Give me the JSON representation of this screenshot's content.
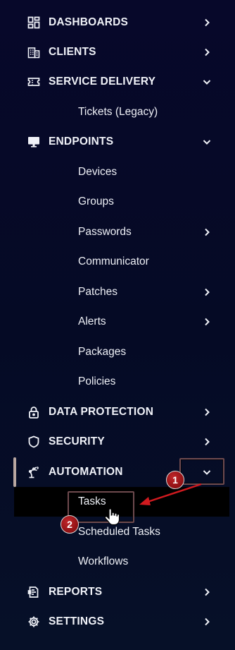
{
  "nav": {
    "dashboards": "DASHBOARDS",
    "clients": "CLIENTS",
    "service_delivery": "SERVICE DELIVERY",
    "tickets_legacy": "Tickets (Legacy)",
    "endpoints": "ENDPOINTS",
    "devices": "Devices",
    "groups": "Groups",
    "passwords": "Passwords",
    "communicator": "Communicator",
    "patches": "Patches",
    "alerts": "Alerts",
    "packages": "Packages",
    "policies": "Policies",
    "data_protection": "DATA PROTECTION",
    "security": "SECURITY",
    "automation": "AUTOMATION",
    "tasks": "Tasks",
    "scheduled_tasks": "Scheduled Tasks",
    "workflows": "Workflows",
    "reports": "REPORTS",
    "settings": "SETTINGS"
  },
  "annotations": {
    "step1": "1",
    "step2": "2"
  },
  "colors": {
    "background": "#050a22",
    "text": "#f0f2f8",
    "highlight_border": "#6e4a4e",
    "badge": "#a0161a",
    "arrow": "#d11a1f"
  },
  "icons": {
    "dashboards": "dashboard-grid-icon",
    "clients": "building-icon",
    "service_delivery": "ticket-icon",
    "endpoints": "monitor-icon",
    "data_protection": "lock-icon",
    "security": "shield-icon",
    "automation": "robot-arm-icon",
    "reports": "report-icon",
    "settings": "gear-icon"
  }
}
